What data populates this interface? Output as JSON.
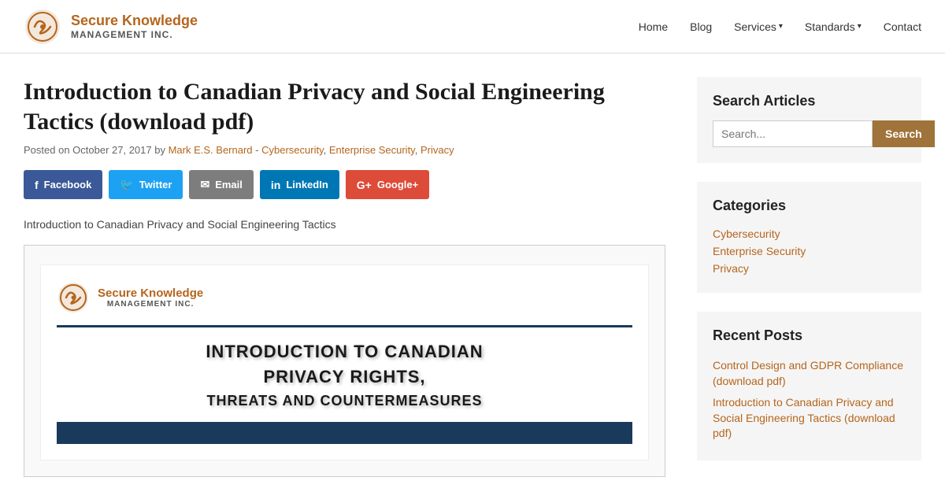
{
  "nav": {
    "logo_line1": "Secure Knowledge",
    "logo_line2": "MANAGEMENT INC.",
    "links": [
      {
        "label": "Home",
        "name": "home"
      },
      {
        "label": "Blog",
        "name": "blog"
      },
      {
        "label": "Services",
        "name": "services",
        "dropdown": true
      },
      {
        "label": "Standards",
        "name": "standards",
        "dropdown": true
      },
      {
        "label": "Contact",
        "name": "contact"
      }
    ]
  },
  "article": {
    "title": "Introduction to Canadian Privacy and Social Engineering Tactics (download pdf)",
    "meta_prefix": "Posted on October 27, 2017 by",
    "author": "Mark E.S. Bernard",
    "author_link_label": "Mark E.S. Bernard",
    "categories_text": "- Cybersecurity, Enterprise Security, Privacy",
    "cat_cybersecurity": "Cybersecurity",
    "cat_enterprise": "Enterprise Security",
    "cat_privacy": "Privacy",
    "body_text": "Introduction to Canadian Privacy and Social Engineering Tactics"
  },
  "share": {
    "facebook": "Facebook",
    "twitter": "Twitter",
    "email": "Email",
    "linkedin": "LinkedIn",
    "googleplus": "Google+"
  },
  "pdf_preview": {
    "logo_line1": "Secure Knowledge",
    "logo_line2": "MANAGEMENT INC.",
    "title_line1": "INTRODUCTION TO CANADIAN",
    "title_line2": "PRIVACY RIGHTS,",
    "title_line3": "THREATS AND COUNTERMEASURES"
  },
  "sidebar": {
    "search_title": "Search Articles",
    "search_placeholder": "Search...",
    "search_btn": "Search",
    "categories_title": "Categories",
    "categories": [
      {
        "label": "Cybersecurity"
      },
      {
        "label": "Enterprise Security"
      },
      {
        "label": "Privacy"
      }
    ],
    "recent_title": "Recent Posts",
    "recent_posts": [
      {
        "label": "Control Design and GDPR Compliance (download pdf)"
      },
      {
        "label": "Introduction to Canadian Privacy and Social Engineering Tactics (download pdf)"
      }
    ]
  }
}
